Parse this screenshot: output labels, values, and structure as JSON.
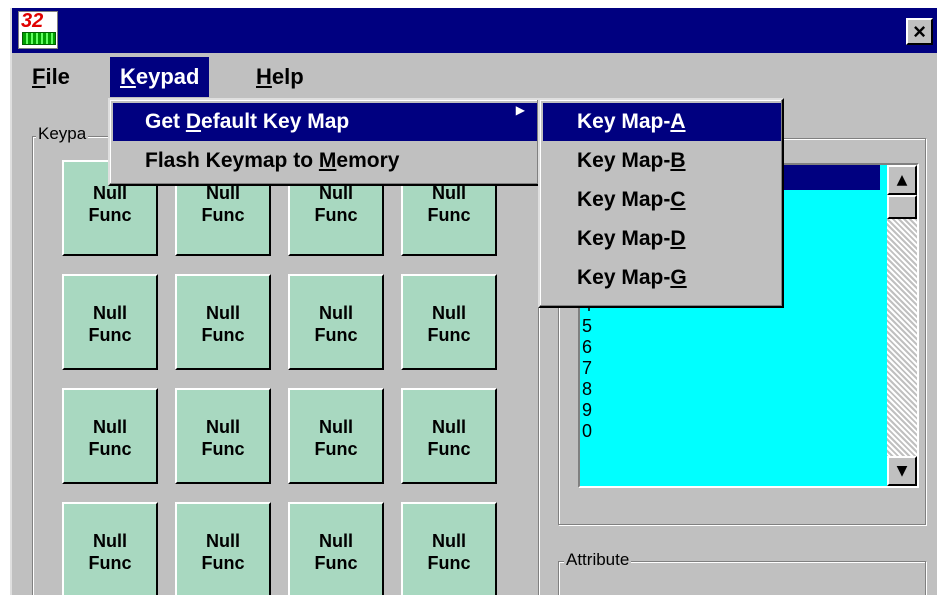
{
  "titlebar": {
    "app_icon_label": "32",
    "close_label": "×"
  },
  "menubar": {
    "items": [
      {
        "label": "File",
        "accel": "F",
        "rest": "ile"
      },
      {
        "label": "Keypad",
        "accel": "K",
        "rest": "eypad"
      },
      {
        "label": "Help",
        "accel": "H",
        "rest": "elp"
      }
    ]
  },
  "keypad_group": {
    "label": "Keypa"
  },
  "keys": [
    [
      "Null",
      "Func"
    ],
    [
      "Null",
      "Func"
    ],
    [
      "Null",
      "Func"
    ],
    [
      "Null",
      "Func"
    ],
    [
      "Null",
      "Func"
    ],
    [
      "Null",
      "Func"
    ],
    [
      "Null",
      "Func"
    ],
    [
      "Null",
      "Func"
    ],
    [
      "Null",
      "Func"
    ],
    [
      "Null",
      "Func"
    ],
    [
      "Null",
      "Func"
    ],
    [
      "Null",
      "Func"
    ],
    [
      "Null",
      "Func"
    ],
    [
      "Null",
      "Func"
    ],
    [
      "Null",
      "Func"
    ],
    [
      "Null",
      "Func"
    ]
  ],
  "key_list": {
    "items": [
      "4",
      "5",
      "6",
      "7",
      "8",
      "9",
      "0"
    ]
  },
  "attribute_group": {
    "label": "Attribute"
  },
  "keypad_menu": {
    "items": [
      {
        "pre": "Get ",
        "accel": "D",
        "post": "efault Key Map",
        "has_submenu": true
      },
      {
        "pre": "Flash Keymap to ",
        "accel": "M",
        "post": "emory",
        "has_submenu": false
      }
    ],
    "submenu_arrow": "▶"
  },
  "keymap_submenu": {
    "items": [
      {
        "pre": "Key Map-",
        "accel": "A"
      },
      {
        "pre": "Key Map-",
        "accel": "B"
      },
      {
        "pre": "Key Map-",
        "accel": "C"
      },
      {
        "pre": "Key Map-",
        "accel": "D"
      },
      {
        "pre": "Key Map-",
        "accel": "G"
      }
    ]
  },
  "scrollbar": {
    "up_arrow": "▲",
    "down_arrow": "▼"
  }
}
